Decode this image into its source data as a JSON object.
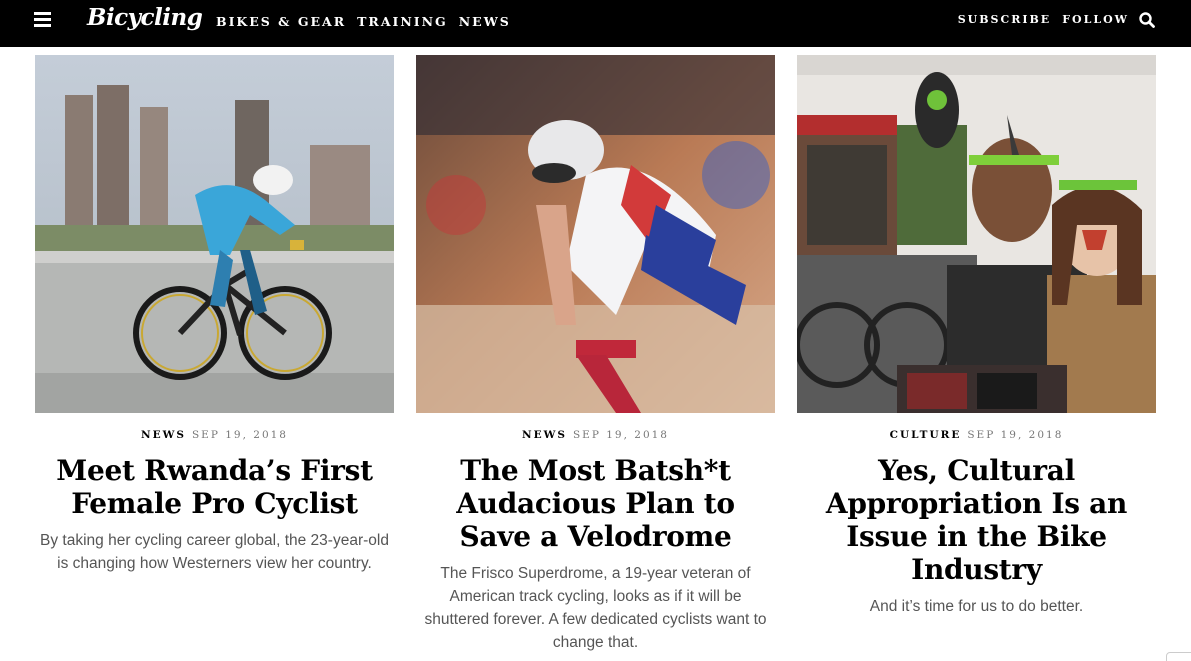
{
  "header": {
    "logo": "Bicycling",
    "nav_left": [
      "Bikes & Gear",
      "Training",
      "News"
    ],
    "nav_right": [
      "Subscribe",
      "Follow"
    ]
  },
  "articles": [
    {
      "section": "News",
      "date": "Sep 19, 2018",
      "headline": "Meet Rwanda’s First Female Pro Cyclist",
      "dek": "By taking her cycling career global, the 23-year-old is changing how Westerners view her country.",
      "image": "cyclist-time-trial-photo"
    },
    {
      "section": "News",
      "date": "Sep 19, 2018",
      "headline": "The Most Batsh*t Audacious Plan to Save a Velodrome",
      "dek": "The Frisco Superdrome, a 19-year veteran of American track cycling, looks as if it will be shuttered forever. A few dedicated cyclists want to change that.",
      "image": "track-cyclist-photo"
    },
    {
      "section": "Culture",
      "date": "Sep 19, 2018",
      "headline": "Yes, Cultural Appropriation Is an Issue in the Bike Industry",
      "dek": "And it’s time for us to do better.",
      "image": "trade-show-selfie-photo"
    }
  ],
  "icons": {
    "menu": "hamburger-icon",
    "search": "search-icon"
  },
  "colors": {
    "header_bg": "#000000",
    "header_text": "#ffffff",
    "headline": "#000000",
    "dek": "#555555",
    "date": "#777777"
  }
}
